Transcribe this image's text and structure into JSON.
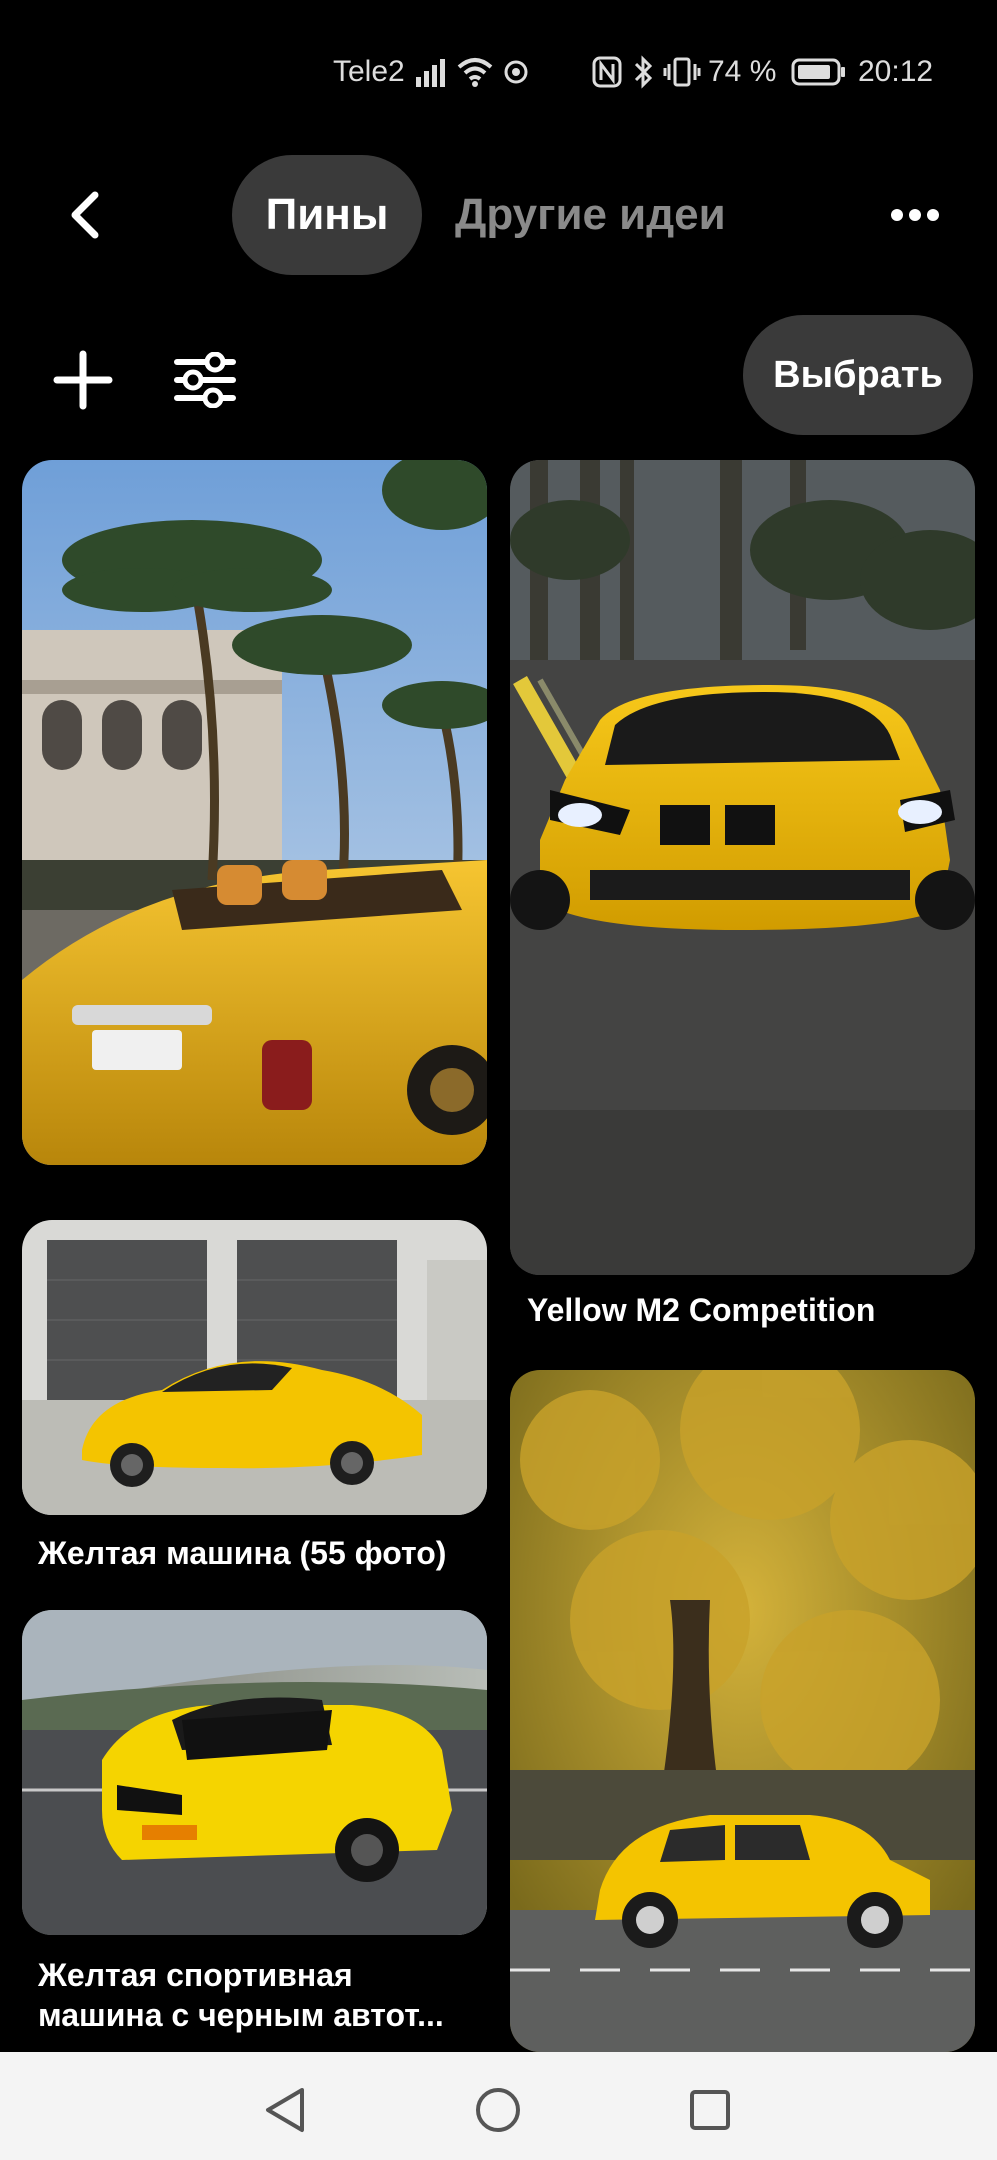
{
  "status_bar": {
    "carrier": "Tele2",
    "battery_percent": "74 %",
    "time": "20:12",
    "icons": [
      "signal-icon",
      "wifi-icon",
      "vibrate-icon",
      "nfc-icon",
      "bluetooth-icon",
      "vibration-icon",
      "battery-icon"
    ]
  },
  "header": {
    "tabs": [
      {
        "label": "Пины",
        "active": true
      },
      {
        "label": "Другие идеи",
        "active": false
      }
    ],
    "back_icon": "chevron-left-icon",
    "more_icon": "more-horizontal-icon"
  },
  "toolbar": {
    "add_icon": "plus-icon",
    "filter_icon": "sliders-icon",
    "select_label": "Выбрать"
  },
  "pins": [
    {
      "image": "yellow-rolls-royce-convertible",
      "title": ""
    },
    {
      "image": "yellow-bmw-m2",
      "title": "Yellow M2 Competition"
    },
    {
      "image": "yellow-ferrari",
      "title": "Желтая машина (55 фото)"
    },
    {
      "image": "yellow-vw-beetle-under-ginkgo",
      "title": ""
    },
    {
      "image": "yellow-camaro",
      "title": "Желтая спортивная машина с черным автот..."
    }
  ],
  "navigation": {
    "icons": [
      "back-triangle-icon",
      "home-circle-icon",
      "recents-square-icon"
    ]
  },
  "colors": {
    "background": "#000000",
    "pill": "#3a3a3a",
    "inactive_tab": "#8a8a8a",
    "car_yellow": "#f2c200"
  }
}
